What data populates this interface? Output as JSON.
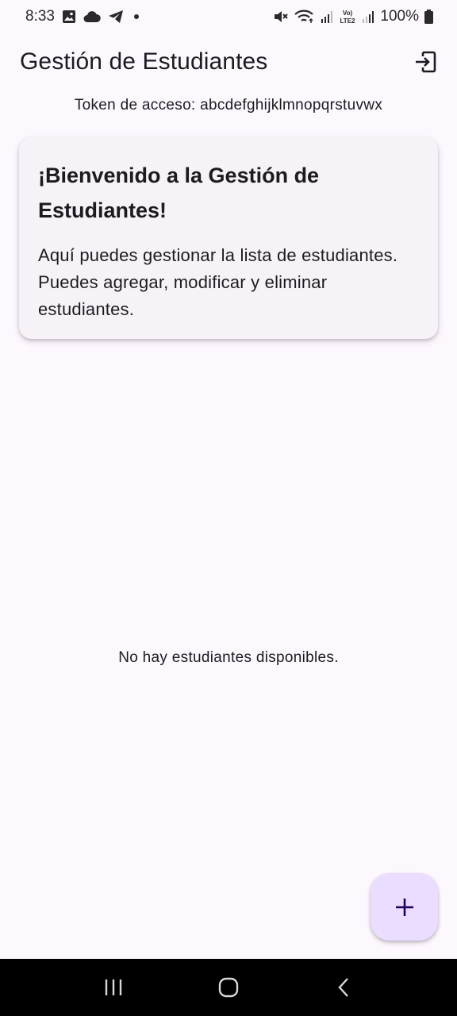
{
  "status_bar": {
    "time": "8:33",
    "battery": "100%",
    "left_icons": [
      "image-icon",
      "cloud-icon",
      "telegram-icon",
      "dot-icon"
    ],
    "right_icons": [
      "mute-icon",
      "wifi-icon",
      "signal-icon",
      "volte-icon",
      "signal-icon",
      "battery-icon"
    ]
  },
  "app_bar": {
    "title": "Gestión de Estudiantes",
    "action_icon": "logout-icon"
  },
  "token_text": "Token de acceso: abcdefghijklmnopqrstuvwx",
  "welcome_card": {
    "title": "¡Bienvenido a la Gestión de Estudiantes!",
    "body": "Aquí puedes gestionar la lista de estudiantes. Puedes agregar, modificar y eliminar estudiantes."
  },
  "empty_message": "No hay estudiantes disponibles.",
  "fab": {
    "icon": "add-icon"
  },
  "nav_bar": {
    "buttons": [
      "recent-apps-icon",
      "home-icon",
      "back-icon"
    ]
  },
  "colors": {
    "background": "#fdf7fe",
    "card_background": "#f6f2f8",
    "fab_background": "#ebddff",
    "text": "#1d1b20",
    "nav_background": "#000000"
  }
}
